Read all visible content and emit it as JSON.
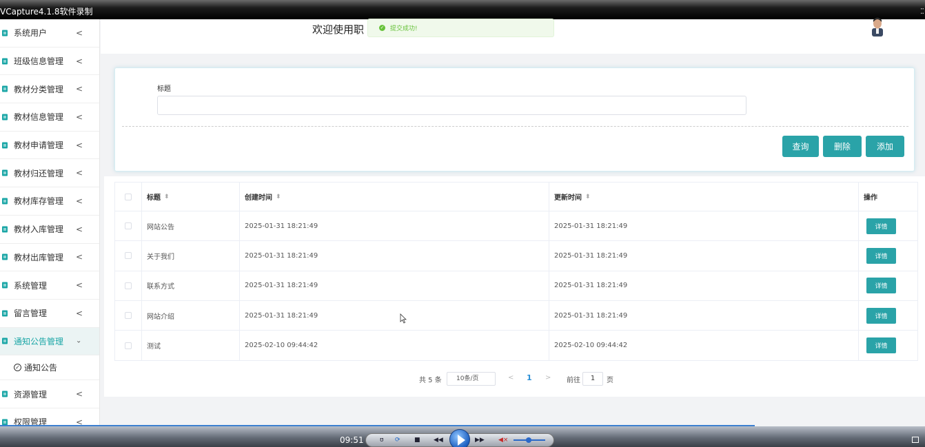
{
  "recorder": {
    "title": "VCapture4.1.8软件录制"
  },
  "sidebar": {
    "items": [
      {
        "label": "系统用户"
      },
      {
        "label": "班级信息管理"
      },
      {
        "label": "教材分类管理"
      },
      {
        "label": "教材信息管理"
      },
      {
        "label": "教材申请管理"
      },
      {
        "label": "教材归还管理"
      },
      {
        "label": "教材库存管理"
      },
      {
        "label": "教材入库管理"
      },
      {
        "label": "教材出库管理"
      },
      {
        "label": "系统管理"
      },
      {
        "label": "留言管理"
      },
      {
        "label": "通知公告管理"
      }
    ],
    "submenu": {
      "label": "通知公告"
    },
    "items_after": [
      {
        "label": "资源管理"
      },
      {
        "label": "权限管理"
      }
    ],
    "arrow_collapsed": "<",
    "arrow_expanded": "⌄"
  },
  "header": {
    "welcome": "欢迎使用职",
    "toast": "提交成功!"
  },
  "search": {
    "label": "标题",
    "value": "",
    "query_label": "查询",
    "delete_label": "删除",
    "add_label": "添加"
  },
  "table": {
    "headers": {
      "title": "标题",
      "created": "创建时间",
      "updated": "更新时间",
      "op": "操作"
    },
    "detail_label": "详情",
    "rows": [
      {
        "title": "网站公告",
        "created": "2025-01-31 18:21:49",
        "updated": "2025-01-31 18:21:49"
      },
      {
        "title": "关于我们",
        "created": "2025-01-31 18:21:49",
        "updated": "2025-01-31 18:21:49"
      },
      {
        "title": "联系方式",
        "created": "2025-01-31 18:21:49",
        "updated": "2025-01-31 18:21:49"
      },
      {
        "title": "网站介绍",
        "created": "2025-01-31 18:21:49",
        "updated": "2025-01-31 18:21:49"
      },
      {
        "title": "测试",
        "created": "2025-02-10 09:44:42",
        "updated": "2025-02-10 09:44:42"
      }
    ]
  },
  "pagination": {
    "total": "共 5 条",
    "page_size": "10条/页",
    "prev": "<",
    "current": "1",
    "next": ">",
    "goto": "前往",
    "goto_value": "1",
    "page_suffix": "页"
  },
  "player": {
    "time": "09:51"
  },
  "colors": {
    "accent": "#2aa3a8",
    "toast_bg": "#f0f9eb",
    "toast_text": "#67c23a",
    "page_active": "#2a8fd6"
  }
}
